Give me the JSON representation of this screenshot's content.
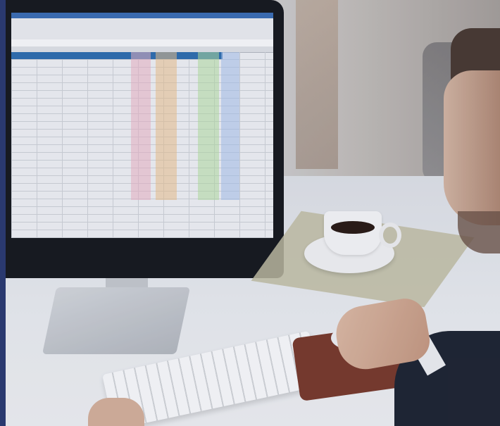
{
  "image": {
    "description": "",
    "colors": {
      "accent_strip": "#2b3a70",
      "spreadsheet_header": "#2f6fb0",
      "coffee": "#2a1a12",
      "mousepad": "#7b3a2a"
    },
    "spreadsheet_column_bands": [
      "#f3b6c6",
      "#f1c48a",
      "#b7e3a0",
      "#a8c4ee"
    ],
    "icons": [
      "monitor-icon",
      "keyboard-icon",
      "coffee-cup-icon",
      "mouse-icon"
    ]
  }
}
